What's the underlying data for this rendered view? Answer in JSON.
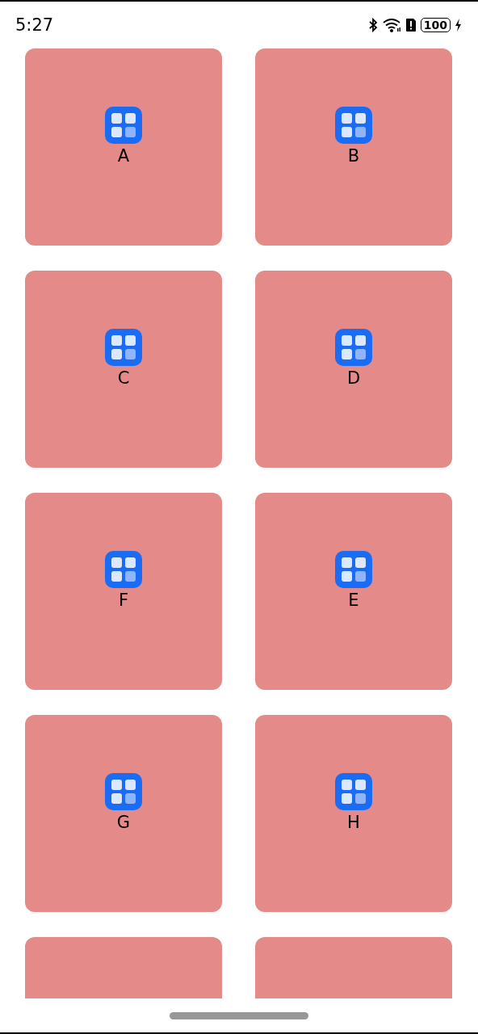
{
  "status_bar": {
    "time": "5:27",
    "battery": "100"
  },
  "cards": [
    {
      "kind": "full",
      "label": "A"
    },
    {
      "kind": "full",
      "label": "B"
    },
    {
      "kind": "full",
      "label": "C"
    },
    {
      "kind": "full",
      "label": "D"
    },
    {
      "kind": "full",
      "label": "F"
    },
    {
      "kind": "full",
      "label": "E"
    },
    {
      "kind": "full",
      "label": "G"
    },
    {
      "kind": "full",
      "label": "H"
    },
    {
      "kind": "partial"
    },
    {
      "kind": "partial"
    }
  ]
}
